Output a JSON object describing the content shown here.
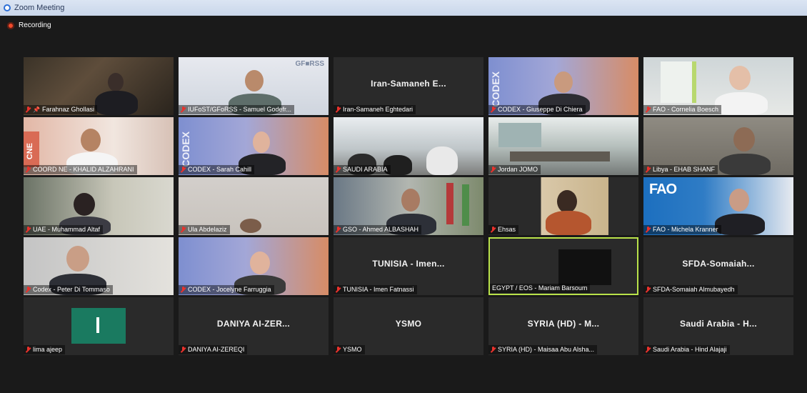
{
  "window": {
    "title": "Zoom Meeting"
  },
  "recording": {
    "label": "Recording"
  },
  "participants": [
    {
      "name": "Farahnaz Ghollasi",
      "pinned": true
    },
    {
      "name": "IUFoST/GFoRSS - Samuel Godefr..."
    },
    {
      "name": "Iran-Samaneh Eghtedari",
      "display_label": "Iran-Samaneh E..."
    },
    {
      "name": "CODEX - Giuseppe Di Chiera"
    },
    {
      "name": "FAO - Cornelia Boesch"
    },
    {
      "name": "COORD NE - KHALID ALZAHRANI"
    },
    {
      "name": "CODEX - Sarah Cahill"
    },
    {
      "name": "SAUDI ARABIA"
    },
    {
      "name": "Jordan JOMO"
    },
    {
      "name": "Libya - EHAB SHANF"
    },
    {
      "name": "UAE - Muhammad Altaf"
    },
    {
      "name": "Ula Abdelaziz"
    },
    {
      "name": "GSO - Ahmed ALBASHAH"
    },
    {
      "name": "Ehsas"
    },
    {
      "name": "FAO - Michela Kranner"
    },
    {
      "name": "Codex - Peter Di Tommaso"
    },
    {
      "name": "CODEX - Jocelyne Farruggia"
    },
    {
      "name": "TUNISIA - Imen Fatnassi",
      "display_label": "TUNISIA - Imen..."
    },
    {
      "name": "EGYPT / EOS - Mariam Barsoum",
      "active_speaker": true
    },
    {
      "name": "SFDA-Somaiah Almubayedh",
      "display_label": "SFDA-Somaiah..."
    },
    {
      "name": "lima ajeep"
    },
    {
      "name": "DANIYA AI-ZEREQI",
      "display_label": "DANIYA AI-ZER..."
    },
    {
      "name": "YSMO",
      "display_label": "YSMO"
    },
    {
      "name": "SYRIA (HD) - Maisaa Abu Alsha...",
      "display_label": "SYRIA (HD) - M..."
    },
    {
      "name": "Saudi Arabia - Hind Alajaji",
      "display_label": "Saudi Arabia - H..."
    }
  ],
  "colors": {
    "active_speaker_border": "#b9e24a",
    "muted_mic": "#e8322c",
    "recording_dot": "#f04a2b",
    "background": "#1a1a1a"
  },
  "tile_logos": {
    "gforss": "GF■RSS",
    "codex": "CODEX",
    "cne": "CNE",
    "fao": "FAO"
  }
}
